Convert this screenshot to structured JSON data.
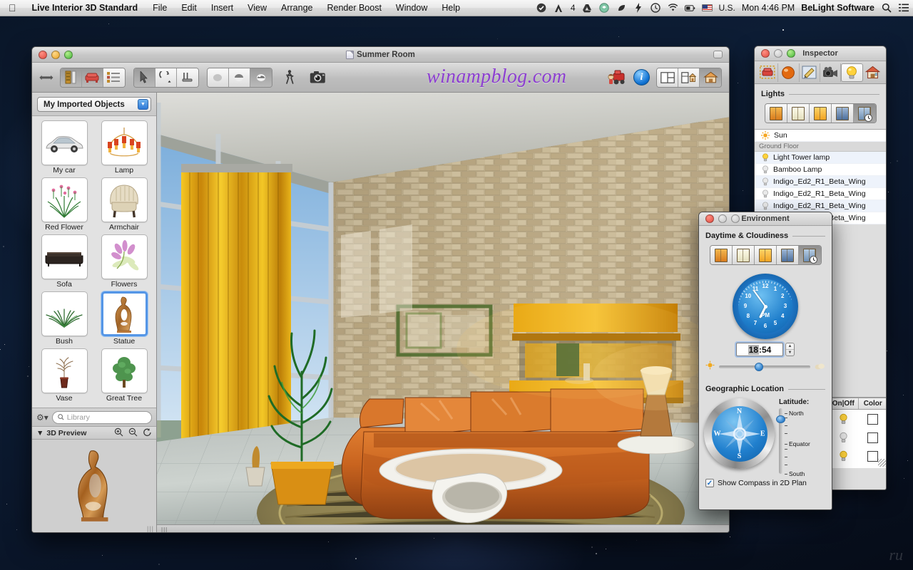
{
  "menubar": {
    "apple_icon": "apple-logo-icon",
    "app_name": "Live Interior 3D Standard",
    "menus": [
      "File",
      "Edit",
      "Insert",
      "View",
      "Arrange",
      "Render Boost",
      "Window",
      "Help"
    ],
    "status_icons": [
      "checkmark-circle-icon",
      "adobe-icon",
      "google-drive-icon",
      "dropbox-icon",
      "evernote-icon",
      "flash-icon",
      "time-machine-icon",
      "wifi-icon",
      "battery-icon"
    ],
    "adobe_badge": "4",
    "input_source": "U.S.",
    "clock": "Mon 4:46 PM",
    "user": "BeLight Software",
    "search_icon": "search-icon",
    "notification_icon": "notification-center-icon"
  },
  "main_window": {
    "title": "Summer Room",
    "watermark": "winampblog.com",
    "traffic_lights": [
      "close",
      "minimize",
      "zoom"
    ],
    "toolbar": {
      "nav_arrows": "back-forward-arrows",
      "view_segment": [
        "floor-plan-icon",
        "furniture-icon",
        "list-view-icon"
      ],
      "tool_segment": [
        "arrow-select-icon",
        "rotate-icon",
        "measure-icon"
      ],
      "shading_segment": [
        "flat-shading-icon",
        "gouraud-shading-icon",
        "phong-shading-icon"
      ],
      "walkthrough_icon": "walk-person-icon",
      "camera_icon": "camera-icon",
      "render_icon": "render-boost-icon",
      "info_icon": "info-icon",
      "layout_segment": [
        "split-view-icon",
        "plan-3d-icon",
        "full-3d-icon"
      ]
    }
  },
  "sidebar": {
    "library_popup": "My Imported Objects",
    "objects": [
      {
        "label": "My car",
        "icon": "car-icon",
        "selected": false
      },
      {
        "label": "Lamp",
        "icon": "chandelier-icon",
        "selected": false
      },
      {
        "label": "Red Flower",
        "icon": "red-flower-icon",
        "selected": false
      },
      {
        "label": "Armchair",
        "icon": "armchair-icon",
        "selected": false
      },
      {
        "label": "Sofa",
        "icon": "sofa-icon",
        "selected": false
      },
      {
        "label": "Flowers",
        "icon": "flowers-icon",
        "selected": false
      },
      {
        "label": "Bush",
        "icon": "bush-icon",
        "selected": false
      },
      {
        "label": "Statue",
        "icon": "statue-icon",
        "selected": true
      },
      {
        "label": "Vase",
        "icon": "vase-icon",
        "selected": false
      },
      {
        "label": "Great Tree",
        "icon": "tree-icon",
        "selected": false
      }
    ],
    "gear_icon": "gear-icon",
    "search_placeholder": "Library",
    "preview_header": "3D Preview",
    "preview_zoom_in": "zoom-in-icon",
    "preview_zoom_out": "zoom-out-icon",
    "preview_reset": "rotate-reset-icon"
  },
  "inspector": {
    "title": "Inspector",
    "tabs": [
      "object-inspector-icon",
      "material-inspector-icon",
      "edit-inspector-icon",
      "camera-inspector-icon",
      "light-inspector-icon",
      "house-inspector-icon"
    ],
    "active_tab_index": 4,
    "section_title": "Lights",
    "daylight_buttons": [
      "sunrise-icon",
      "daylight-icon",
      "sunset-icon",
      "night-icon",
      "custom-time-icon"
    ],
    "active_daylight_index": 4,
    "lights": [
      {
        "name": "Sun",
        "type": "sun",
        "group": false
      },
      {
        "name": "Ground Floor",
        "type": "group",
        "group": true
      },
      {
        "name": "Light Tower lamp",
        "type": "on",
        "group": false
      },
      {
        "name": "Bamboo Lamp",
        "type": "off",
        "group": false
      },
      {
        "name": "Indigo_Ed2_R1_Beta_Wing",
        "type": "off",
        "group": false
      },
      {
        "name": "Indigo_Ed2_R1_Beta_Wing",
        "type": "off",
        "group": false
      },
      {
        "name": "Indigo_Ed2_R1_Beta_Wing",
        "type": "off",
        "group": false
      },
      {
        "name": "Indigo_Ed2_R1_Beta_Wing",
        "type": "off",
        "group": false
      }
    ],
    "columns": [
      "On|Off",
      "Color"
    ],
    "column_rows": [
      {
        "state": "on",
        "color": "#ffffff"
      },
      {
        "state": "off",
        "color": "#ffffff"
      },
      {
        "state": "on",
        "color": "#ffffff"
      }
    ]
  },
  "environment": {
    "title": "Environment",
    "daytime_section": "Daytime & Cloudiness",
    "cloud_buttons": [
      "sunrise-icon",
      "daylight-icon",
      "sunset-icon",
      "night-icon",
      "custom-time-icon"
    ],
    "active_cloud_index": 4,
    "clock": {
      "numbers": [
        "12",
        "1",
        "2",
        "3",
        "4",
        "5",
        "6",
        "7",
        "8",
        "9",
        "10",
        "11"
      ],
      "meridiem": "PM",
      "hour": 6,
      "minute": 54
    },
    "time_value_hours": "18",
    "time_separator": ":",
    "time_value_minutes": "54",
    "stepper_up": "stepper-up-icon",
    "stepper_down": "stepper-down-icon",
    "slider_left_icon": "sun-icon",
    "slider_right_icon": "cloud-icon",
    "slider_percent": 44,
    "geo_section": "Geographic Location",
    "compass_directions": [
      "N",
      "E",
      "S",
      "W"
    ],
    "latitude_label": "Latitude:",
    "latitude_ticks": [
      "North",
      "Equator",
      "South"
    ],
    "latitude_percent": 16,
    "checkbox_label": "Show Compass in 2D Plan",
    "checkbox_checked": true
  },
  "colors": {
    "accent_blue": "#2f80cc",
    "selection_blue": "#5596e6",
    "watermark_purple": "#8c3fd0",
    "sofa_orange": "#c9641f",
    "curtain_gold": "#e8a80c",
    "stone_wall": "#b9a278"
  }
}
